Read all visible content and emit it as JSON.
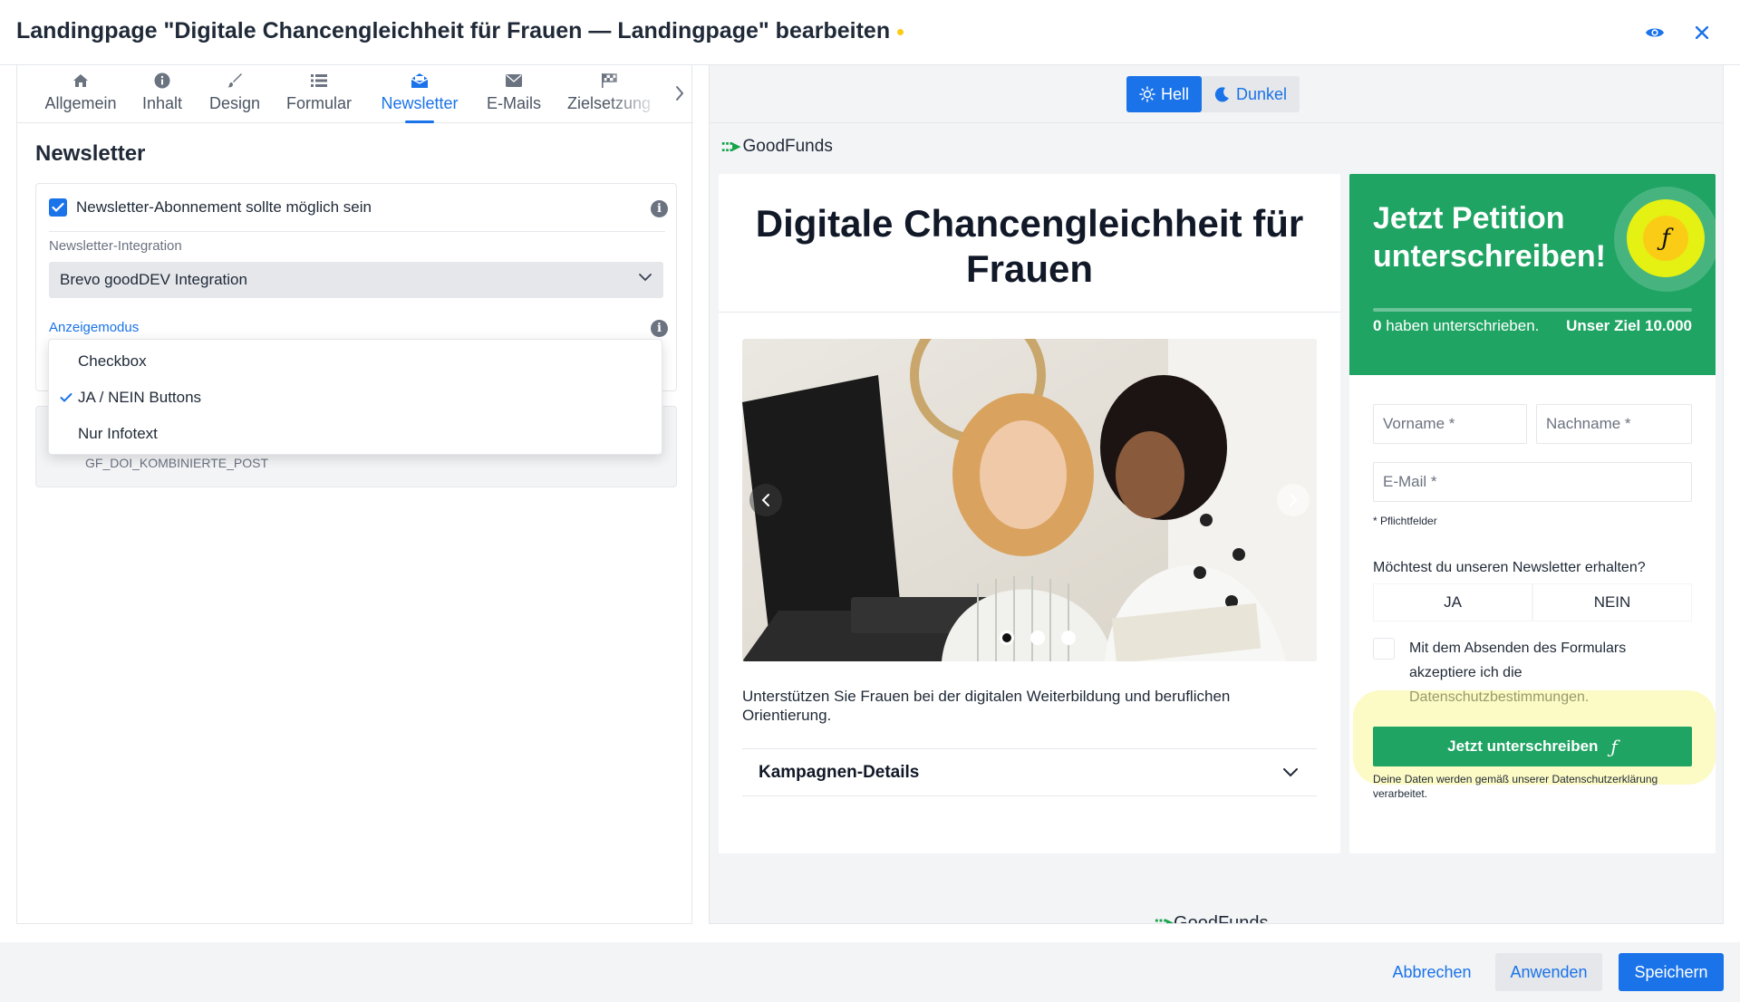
{
  "header": {
    "title": "Landingpage \"Digitale Chancengleichheit für Frauen — Landingpage\" bearbeiten"
  },
  "tabs": [
    {
      "label": "Allgemein",
      "icon": "home-icon"
    },
    {
      "label": "Inhalt",
      "icon": "info-icon"
    },
    {
      "label": "Design",
      "icon": "brush-icon"
    },
    {
      "label": "Formular",
      "icon": "list-icon"
    },
    {
      "label": "Newsletter",
      "icon": "envelope-open-icon",
      "active": true
    },
    {
      "label": "E-Mails",
      "icon": "envelope-icon"
    },
    {
      "label": "Zielsetzung",
      "icon": "flag-icon"
    }
  ],
  "newsletter": {
    "section_title": "Newsletter",
    "subscription_label": "Newsletter-Abonnement sollte möglich sein",
    "subscription_checked": true,
    "integration_label": "Newsletter-Integration",
    "integration_value": "Brevo goodDEV Integration",
    "mode_label": "Anzeigemodus",
    "mode_options": [
      "Checkbox",
      "JA / NEIN Buttons",
      "Nur Infotext"
    ],
    "mode_selected": "JA / NEIN Buttons",
    "template_value": "GF_DOI_KOMBINIERTE_POST"
  },
  "preview": {
    "theme_light": "Hell",
    "theme_dark": "Dunkel",
    "logo": "GoodFunds",
    "headline": "Digitale Chancengleichheit für Frauen",
    "description": "Unterstützen Sie Frauen bei der digitalen Weiterbildung und beruflichen Orientierung.",
    "accordion_label": "Kampagnen-Details",
    "petition": {
      "title": "Jetzt Petition unterschreiben!",
      "count_number": "0",
      "count_text": "haben unterschrieben.",
      "goal": "Unser Ziel 10.000",
      "progress": 0,
      "firstname_placeholder": "Vorname *",
      "lastname_placeholder": "Nachname *",
      "email_placeholder": "E-Mail *",
      "required_note": "* Pflichtfelder",
      "newsletter_question": "Möchtest du unseren Newsletter erhalten?",
      "yes_label": "JA",
      "no_label": "NEIN",
      "consent_text": "Mit dem Absenden des Formulars akzeptiere ich die Datenschutzbestimmungen.",
      "submit_label": "Jetzt unterschreiben",
      "privacy_note": "Deine Daten werden gemäß unserer Datenschutzerklärung verarbeitet.",
      "accent_color": "#1fa463"
    },
    "footer_logo": "GoodFunds"
  },
  "footer": {
    "cancel_label": "Abbrechen",
    "apply_label": "Anwenden",
    "save_label": "Speichern"
  },
  "colors": {
    "primary": "#1a73e8",
    "petition_green": "#1fa463",
    "highlight_yellow": "#facc15"
  }
}
